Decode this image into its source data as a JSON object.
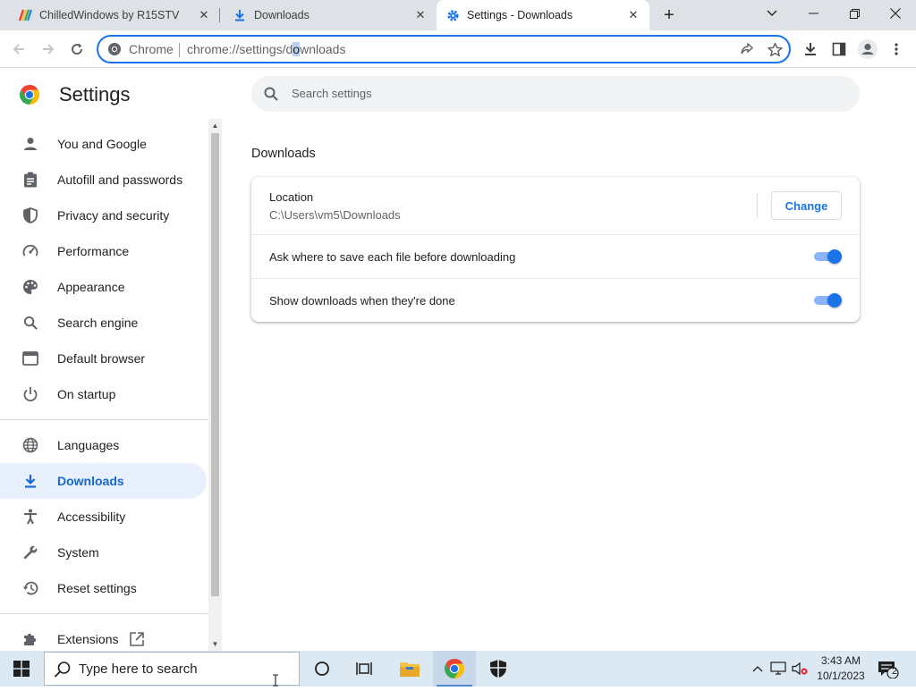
{
  "browser": {
    "tabs": [
      {
        "title": "ChilledWindows by R15STV",
        "icon": "rainbow-logo-icon",
        "active": false
      },
      {
        "title": "Downloads",
        "icon": "download-icon",
        "active": false
      },
      {
        "title": "Settings - Downloads",
        "icon": "gear-icon",
        "active": true
      }
    ],
    "new_tab_label": "+",
    "omnibox": {
      "chip": "Chrome",
      "url_before": "chrome://settings/d",
      "url_selected": "o",
      "url_after": "wnloads"
    }
  },
  "settings": {
    "title": "Settings",
    "search_placeholder": "Search settings",
    "sidebar": {
      "group1": [
        {
          "label": "You and Google",
          "icon": "person-icon"
        },
        {
          "label": "Autofill and passwords",
          "icon": "clipboard-icon"
        },
        {
          "label": "Privacy and security",
          "icon": "shield-icon"
        },
        {
          "label": "Performance",
          "icon": "speedometer-icon"
        },
        {
          "label": "Appearance",
          "icon": "palette-icon"
        },
        {
          "label": "Search engine",
          "icon": "search-icon"
        },
        {
          "label": "Default browser",
          "icon": "browser-window-icon"
        },
        {
          "label": "On startup",
          "icon": "power-icon"
        }
      ],
      "group2": [
        {
          "label": "Languages",
          "icon": "globe-icon"
        },
        {
          "label": "Downloads",
          "icon": "download-icon",
          "selected": true
        },
        {
          "label": "Accessibility",
          "icon": "accessibility-icon"
        },
        {
          "label": "System",
          "icon": "wrench-icon"
        },
        {
          "label": "Reset settings",
          "icon": "restore-icon"
        }
      ],
      "group3": [
        {
          "label": "Extensions",
          "icon": "puzzle-icon",
          "external": "open-in-new-icon"
        }
      ]
    },
    "section_title": "Downloads",
    "location": {
      "label": "Location",
      "path": "C:\\Users\\vm5\\Downloads",
      "change_label": "Change"
    },
    "toggles": [
      {
        "label": "Ask where to save each file before downloading",
        "on": true
      },
      {
        "label": "Show downloads when they're done",
        "on": true
      }
    ]
  },
  "taskbar": {
    "search_placeholder": "Type here to search",
    "clock_time": "3:43 AM",
    "clock_date": "10/1/2023",
    "notification_count": "2"
  },
  "colors": {
    "accent": "#1a73e8",
    "selected_bg": "#e8f0fe",
    "tabstrip_bg": "#dee1e6",
    "taskbar_bg": "#dce8f2"
  }
}
